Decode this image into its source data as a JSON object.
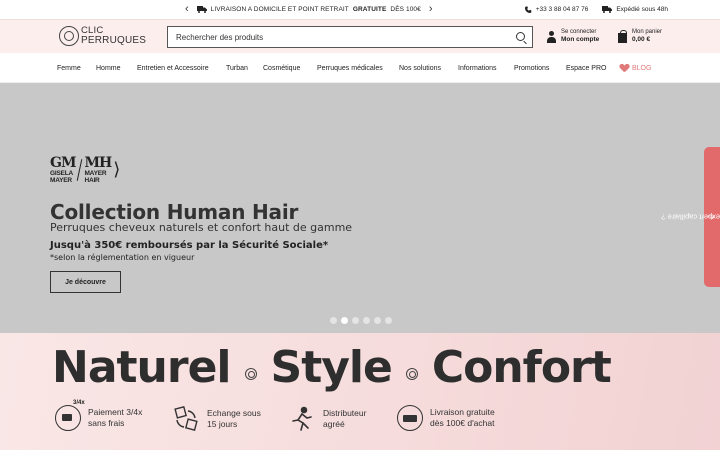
{
  "promo": {
    "prev": "‹",
    "next": "›",
    "message_pre": "LIVRAISON A DOMICILE ET POINT RETRAIT",
    "message_bold": "GRATUITE",
    "message_post": "DÈS 100€",
    "phone": "+33 3 88 04 87 76",
    "shipping": "Expédié sous 48h"
  },
  "header": {
    "logo_line1": "CLIC",
    "logo_line2": "PERRUQUES",
    "search_placeholder": "Rechercher des produits",
    "account_line1": "Se connecter",
    "account_line2": "Mon compte",
    "cart_line1": "Mon panier",
    "cart_line2": "0,00 €"
  },
  "nav": {
    "items": [
      "Femme",
      "Homme",
      "Entretien et Accessoire",
      "Turban",
      "Cosmétique",
      "Perruques médicales",
      "Nos solutions",
      "Informations",
      "Promotions",
      "Espace PRO"
    ],
    "blog": "BLOG"
  },
  "hero": {
    "brand_gm": "GM",
    "brand_gm_sub1": "GISELA",
    "brand_gm_sub2": "MAYER",
    "brand_mh": "MH",
    "brand_mh_sub1": "MAYER",
    "brand_mh_sub2": "HAIR",
    "title": "Collection Human Hair",
    "subtitle": "Perruques cheveux naturels et confort haut de gamme",
    "offer": "Jusqu'à 350€ remboursés par la Sécurité Sociale*",
    "note": "*selon la réglementation en vigueur",
    "cta": "Je découvre",
    "slides": 6,
    "active_slide": 2
  },
  "side_tab": "Un conseil d'expert capillaire ?",
  "band": {
    "words": [
      "Naturel",
      "Style",
      "Confort"
    ],
    "features": [
      {
        "line1": "Paiement 3/4x",
        "line2": "sans frais",
        "icon": "payment-icon",
        "badge": "3/4x"
      },
      {
        "line1": "Echange sous",
        "line2": "15 jours",
        "icon": "exchange-box-icon"
      },
      {
        "line1": "Distributeur",
        "line2": "agréé",
        "icon": "runner-icon"
      },
      {
        "line1": "Livraison gratuite",
        "line2": "dès 100€ d'achat",
        "icon": "delivery-van-icon"
      }
    ]
  },
  "colors": {
    "accent": "#e26a6b",
    "header_bg": "#fbeeed",
    "hero_bg": "#c8c8c8"
  }
}
